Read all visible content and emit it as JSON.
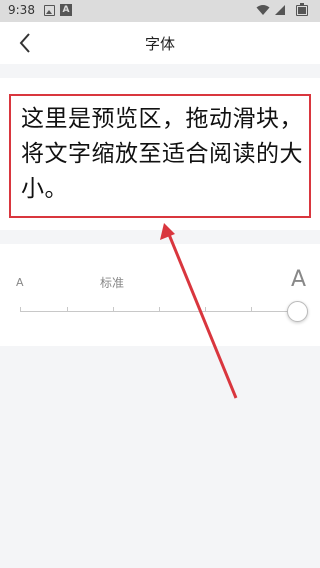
{
  "status_bar": {
    "time": "9:38",
    "notif_letter": "A"
  },
  "header": {
    "title": "字体"
  },
  "preview": {
    "text": "这里是预览区，拖动滑块，将文字缩放至适合阅读的大小。"
  },
  "font_slider": {
    "small_label": "A",
    "standard_label": "标准",
    "large_label": "A",
    "level_fraction": 1.0
  },
  "colors": {
    "annotation_red": "#d9363e",
    "background": "#f4f5f7"
  }
}
